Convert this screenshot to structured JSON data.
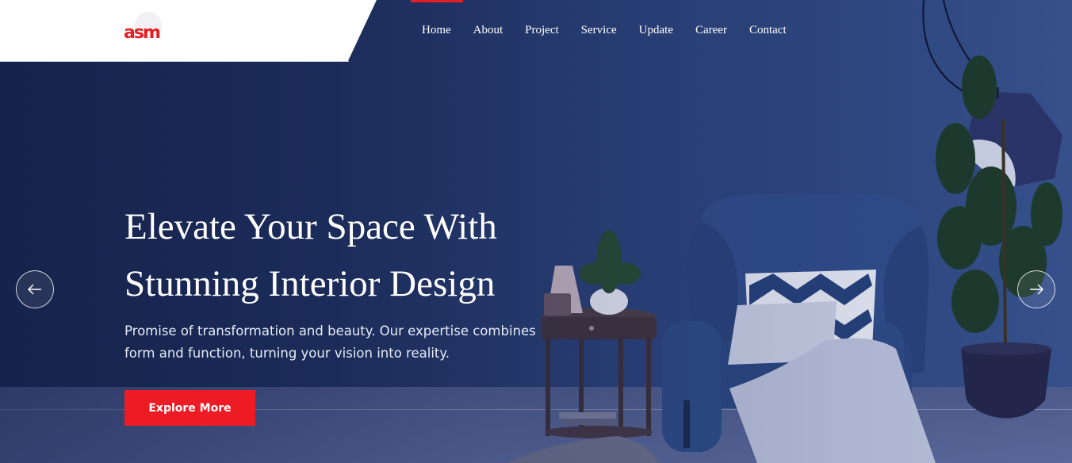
{
  "brand": {
    "logo_text": "asm",
    "accent": "#ed1c24"
  },
  "nav": {
    "items": [
      {
        "label": "Home",
        "active": true
      },
      {
        "label": "About"
      },
      {
        "label": "Project"
      },
      {
        "label": "Service"
      },
      {
        "label": "Update"
      },
      {
        "label": "Career"
      },
      {
        "label": "Contact"
      }
    ]
  },
  "hero": {
    "title_line1": "Elevate Your Space With",
    "title_line2": "Stunning Interior Design",
    "subtitle": "Promise of transformation and beauty. Our expertise combines form and function, turning your vision into reality.",
    "cta_label": "Explore More"
  },
  "slider": {
    "prev_icon": "arrow-left-icon",
    "next_icon": "arrow-right-icon"
  }
}
